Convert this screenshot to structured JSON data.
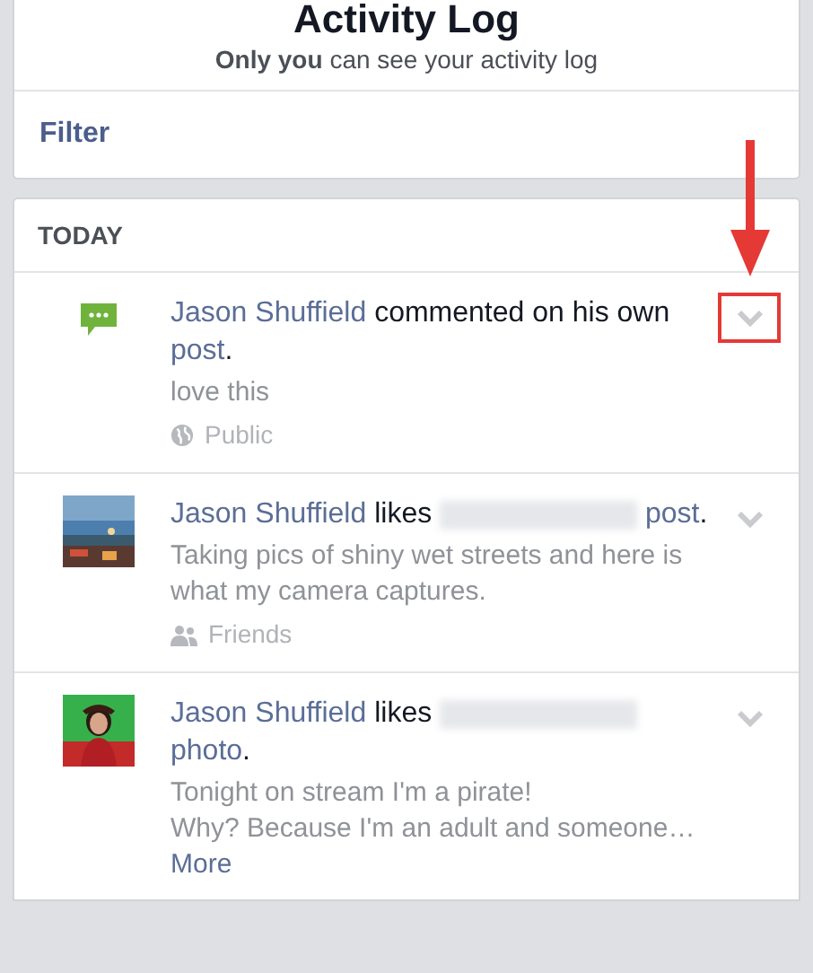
{
  "header": {
    "title": "Activity Log",
    "subtitle_bold": "Only you",
    "subtitle_rest": "can see your activity log",
    "filter": "Filter"
  },
  "section": {
    "heading": "TODAY",
    "items": [
      {
        "kind": "comment",
        "sentence": [
          {
            "kind": "link",
            "text": "Jason Shuffield"
          },
          {
            "kind": "text",
            "text": "commented on his own"
          },
          {
            "kind": "link",
            "text": "post"
          },
          {
            "kind": "text",
            "text": "."
          }
        ],
        "body": "love this",
        "audience": {
          "kind": "public",
          "label": "Public"
        },
        "highlighted": true
      },
      {
        "kind": "street-photo",
        "sentence": [
          {
            "kind": "link",
            "text": "Jason Shuffield"
          },
          {
            "kind": "text",
            "text": "likes"
          },
          {
            "kind": "redacted"
          },
          {
            "kind": "link",
            "text": "post"
          },
          {
            "kind": "text",
            "text": "."
          }
        ],
        "body": "Taking pics of shiny wet streets and here is what my camera captures.",
        "audience": {
          "kind": "friends",
          "label": "Friends"
        },
        "highlighted": false
      },
      {
        "kind": "person-photo",
        "sentence": [
          {
            "kind": "link",
            "text": "Jason Shuffield"
          },
          {
            "kind": "text",
            "text": "likes"
          },
          {
            "kind": "redacted"
          },
          {
            "kind": "link",
            "text": "photo"
          },
          {
            "kind": "text",
            "text": "."
          }
        ],
        "body": "Tonight on stream I'm a pirate!\nWhy? Because I'm an adult and someone…",
        "more": "More",
        "highlighted": false
      }
    ]
  }
}
